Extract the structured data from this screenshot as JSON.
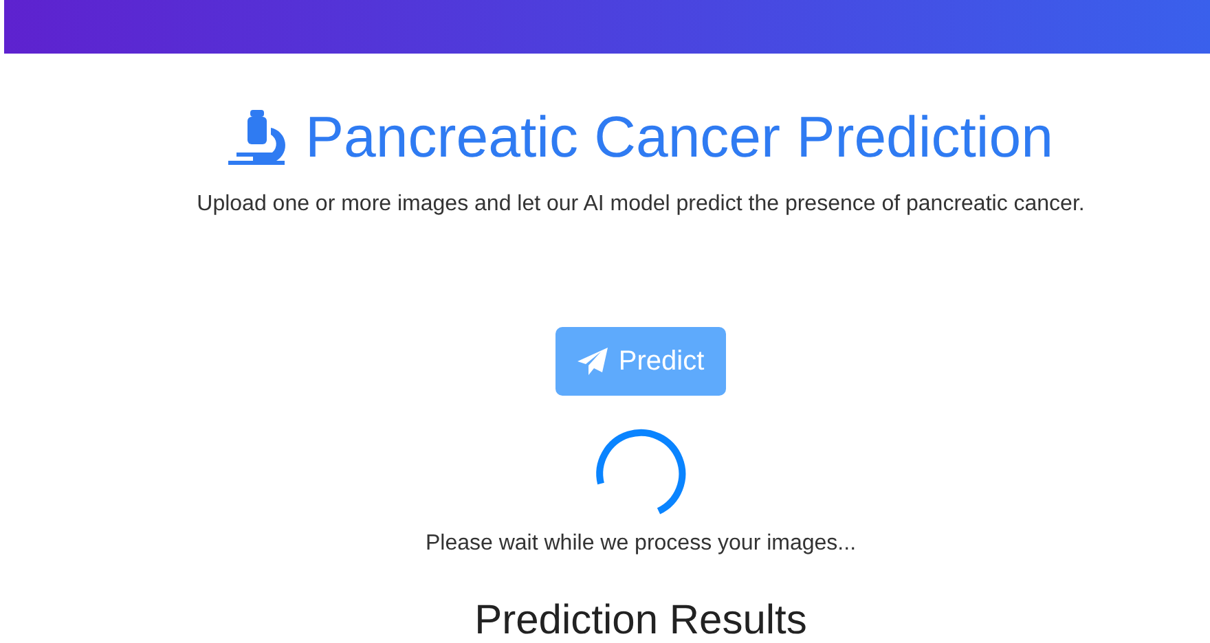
{
  "header": {
    "kind": "gradient-bar"
  },
  "title": "Pancreatic Cancer Prediction",
  "subtitle": "Upload one or more images and let our AI model predict the presence of pancreatic cancer.",
  "predict_button": {
    "label": "Predict",
    "disabled": true
  },
  "loading": {
    "visible": true,
    "message": "Please wait while we process your images..."
  },
  "results": {
    "heading": "Prediction Results"
  }
}
